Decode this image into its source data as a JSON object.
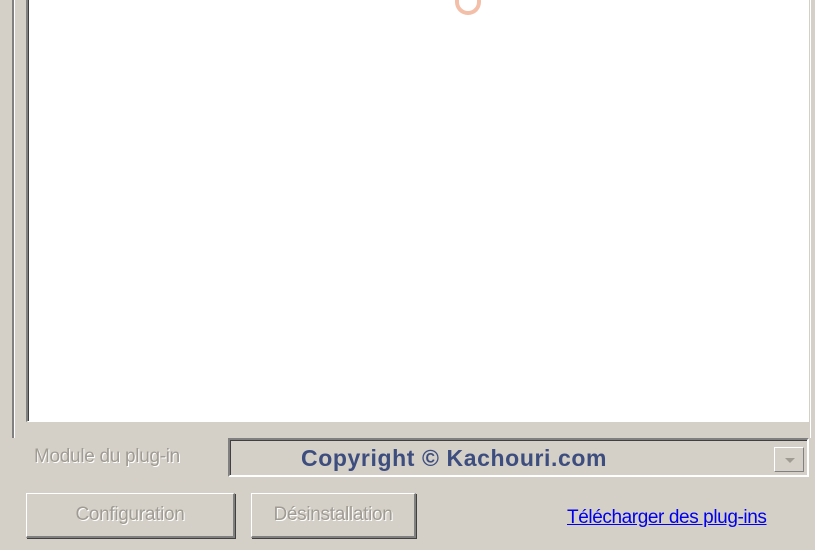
{
  "plugin_list": {
    "items": []
  },
  "plugin_module": {
    "label": "Module du plug-in",
    "selected_value": "Copyright © Kachouri.com"
  },
  "buttons": {
    "configuration": "Configuration",
    "uninstall": "Désinstallation"
  },
  "link": {
    "download": "Télécharger des plug-ins",
    "color": "#0000ee"
  },
  "colors": {
    "dialog_bg": "#d4d0c8",
    "disabled_text": "#a09c94",
    "combo_text": "#3d4d7e"
  }
}
